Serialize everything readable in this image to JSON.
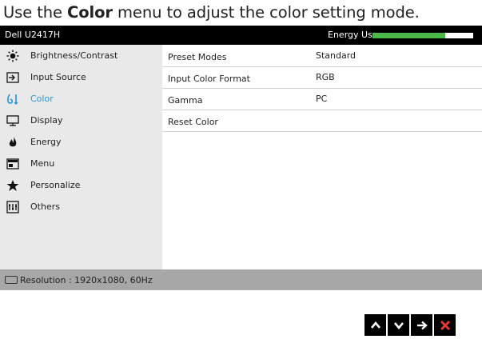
{
  "caption": {
    "pre": "Use the ",
    "bold": "Color",
    "post": " menu to adjust the color setting mode."
  },
  "titlebar": {
    "model": "Dell U2417H",
    "energy_label": "Energy Use",
    "energy_level_fraction": 0.72
  },
  "sidebar": {
    "items": [
      {
        "label": "Brightness/Contrast",
        "icon": "brightness-icon",
        "active": false
      },
      {
        "label": "Input Source",
        "icon": "input-source-icon",
        "active": false
      },
      {
        "label": "Color",
        "icon": "color-icon",
        "active": true
      },
      {
        "label": "Display",
        "icon": "display-icon",
        "active": false
      },
      {
        "label": "Energy",
        "icon": "energy-icon",
        "active": false
      },
      {
        "label": "Menu",
        "icon": "menu-icon",
        "active": false
      },
      {
        "label": "Personalize",
        "icon": "star-icon",
        "active": false
      },
      {
        "label": "Others",
        "icon": "others-icon",
        "active": false
      }
    ]
  },
  "main": {
    "rows": [
      {
        "key": "Preset Modes",
        "value": "Standard"
      },
      {
        "key": "Input Color Format",
        "value": "RGB"
      },
      {
        "key": "Gamma",
        "value": "PC"
      },
      {
        "key": "Reset Color",
        "value": ""
      }
    ]
  },
  "footer": {
    "resolution": "Resolution : 1920x1080, 60Hz",
    "icon": "resolution-icon"
  },
  "nav_buttons": [
    {
      "name": "up",
      "icon": "chevron-up-icon"
    },
    {
      "name": "down",
      "icon": "chevron-down-icon"
    },
    {
      "name": "enter",
      "icon": "arrow-right-icon"
    },
    {
      "name": "exit",
      "icon": "close-icon"
    }
  ],
  "colors": {
    "accent": "#2196d9",
    "energy_green": "#4cb848",
    "exit_red": "#e53935",
    "sidebar_bg": "#e9e9e9",
    "footer_bg": "#a7a7a7"
  }
}
